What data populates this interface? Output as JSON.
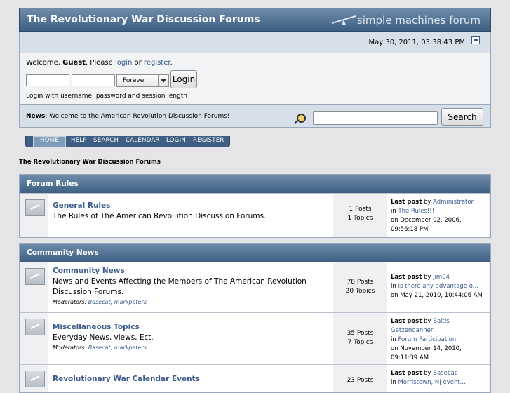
{
  "header": {
    "title": "The Revolutionary War Discussion Forums",
    "logo_text": "simple machines forum",
    "date": "May 30, 2011, 03:38:43 PM"
  },
  "login": {
    "welcome_prefix": "Welcome, ",
    "guest": "Guest",
    "please": ". Please ",
    "login_link": "login",
    "or": " or ",
    "register_link": "register",
    "period": ".",
    "username_value": "",
    "password_value": "",
    "duration_selected": "Forever",
    "login_button": "Login",
    "hint": "Login with username, password and session length"
  },
  "news": {
    "label": "News",
    "text": ": Welcome to the American Revolution Discussion Forums!"
  },
  "search": {
    "value": "",
    "button": "Search"
  },
  "menu": [
    {
      "label": "HOME"
    },
    {
      "label": "HELP"
    },
    {
      "label": "SEARCH"
    },
    {
      "label": "CALENDAR"
    },
    {
      "label": "LOGIN"
    },
    {
      "label": "REGISTER"
    }
  ],
  "breadcrumb": "The Revolutionary War Discussion Forums",
  "categories": [
    {
      "title": "Forum Rules",
      "boards": [
        {
          "name": "General Rules",
          "description": "The Rules of The American Revolution Discussion Forums.",
          "posts": "1 Posts",
          "topics": "1 Topics",
          "last_label": "Last post",
          "by": " by ",
          "last_user": "Administrator",
          "in": "in ",
          "last_topic": "The Rules!!!",
          "last_date": "on December 02, 2006, 09:56:18 PM"
        }
      ]
    },
    {
      "title": "Community News",
      "boards": [
        {
          "name": "Community News",
          "description": "News and Events Affecting the Members of The American Revolution Discussion Forums.",
          "moderators_label": "Moderators:",
          "moderators": "Basecat, markpeters",
          "posts": "78 Posts",
          "topics": "20 Topics",
          "last_label": "Last post",
          "by": " by ",
          "last_user": "jim04",
          "in": "in ",
          "last_topic": "Is there any advantage o...",
          "last_date": "on May 21, 2010, 10:44:06 AM"
        },
        {
          "name": "Miscellaneous Topics",
          "description": "Everyday News, views, Ect.",
          "moderators_label": "Moderators:",
          "moderators": "Basecat, markpeters",
          "posts": "35 Posts",
          "topics": "7 Topics",
          "last_label": "Last post",
          "by": " by ",
          "last_user": "Baltis Getzendanner",
          "in": "in ",
          "last_topic": "Forum Participation",
          "last_date": "on November 14, 2010, 09:11:39 AM"
        },
        {
          "name": "Revolutionary War Calendar Events",
          "posts": "23 Posts",
          "last_label": "Last post",
          "by": " by ",
          "last_user": "Basecat",
          "in": "in ",
          "last_topic": "Morristown, NJ event..."
        }
      ]
    }
  ],
  "colors": {
    "header_dark": "#3e5f83",
    "header_light": "#6f8caa",
    "link": "#3a5a8c",
    "page_bg": "#e5e5e8"
  }
}
